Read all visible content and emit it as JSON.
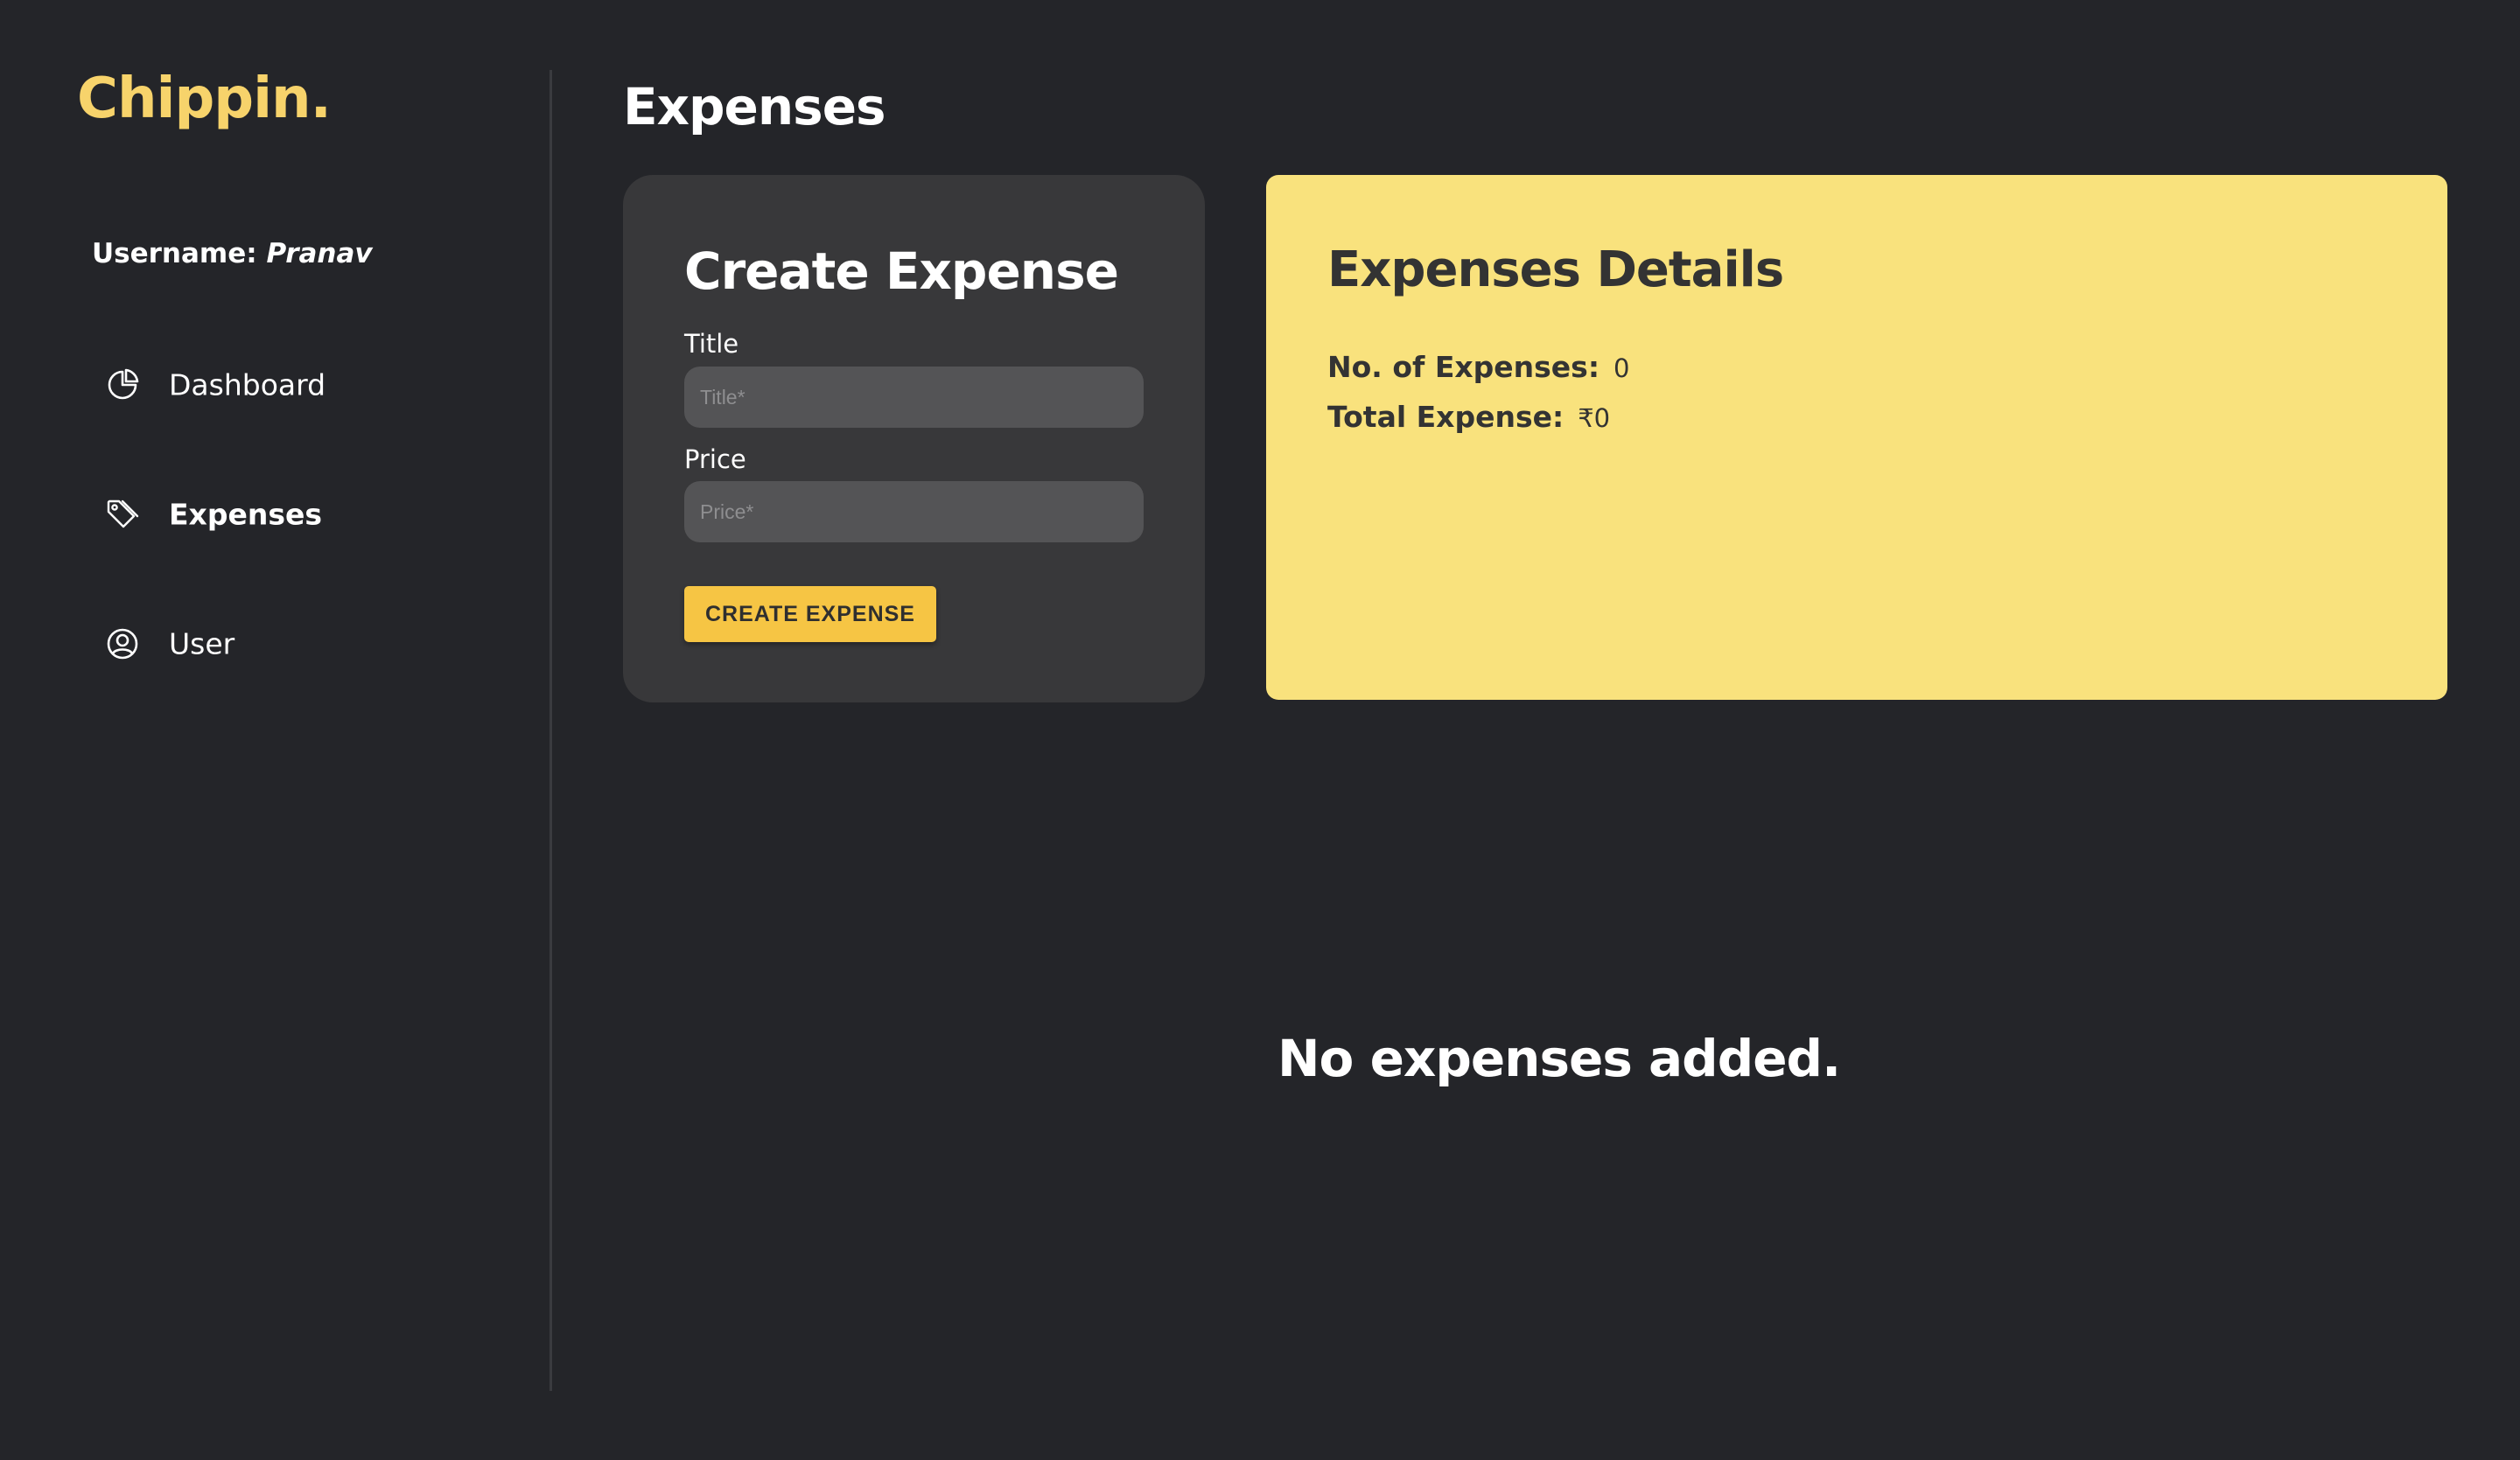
{
  "brand": {
    "name": "Chippin."
  },
  "sidebar": {
    "username_label": "Username:",
    "username_value": "Pranav",
    "items": [
      {
        "label": "Dashboard",
        "icon": "pie-chart-icon",
        "active": false
      },
      {
        "label": "Expenses",
        "icon": "tag-icon",
        "active": true
      },
      {
        "label": "User",
        "icon": "user-circle-icon",
        "active": false
      }
    ]
  },
  "main": {
    "page_title": "Expenses",
    "create": {
      "title": "Create Expense",
      "title_label": "Title",
      "title_placeholder": "Title*",
      "title_value": "",
      "price_label": "Price",
      "price_placeholder": "Price*",
      "price_value": "",
      "button_label": "CREATE EXPENSE"
    },
    "details": {
      "title": "Expenses Details",
      "count_label": "No. of Expenses:",
      "count_value": "0",
      "total_label": "Total Expense:",
      "total_value": "₹0"
    },
    "empty_message": "No expenses added."
  },
  "colors": {
    "background": "#242529",
    "accent": "#f7d36b",
    "button": "#f6c544",
    "card_dark": "#38383a",
    "card_yellow": "#f9e27d"
  }
}
